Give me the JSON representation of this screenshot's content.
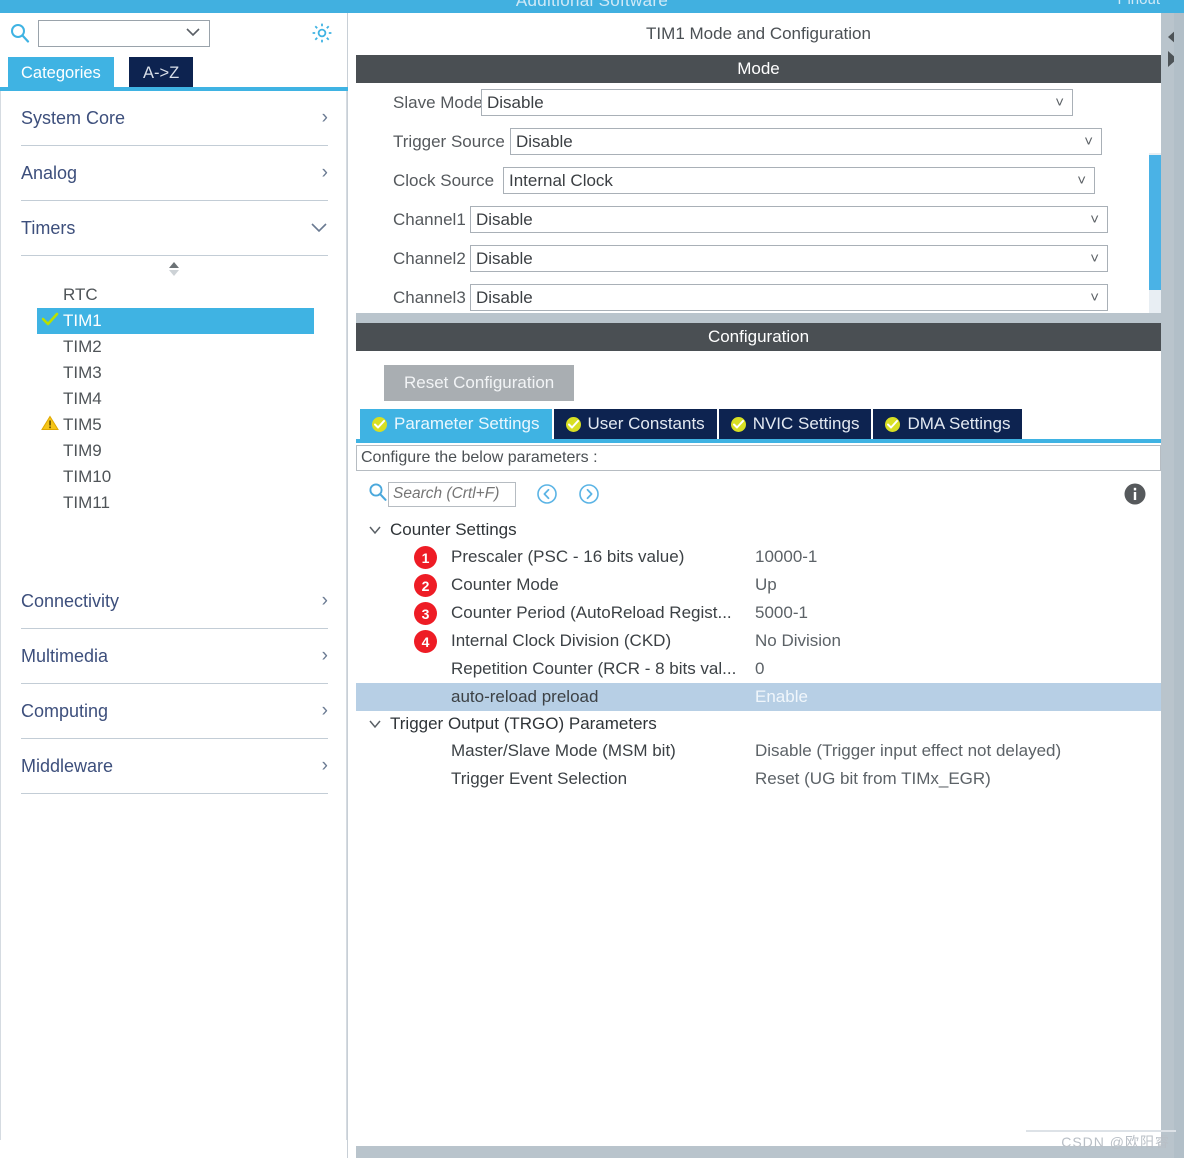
{
  "window": {
    "title": "Additional Software",
    "right_label": "Pinout"
  },
  "sidebar": {
    "search": {
      "icon": "search-icon",
      "value": "",
      "placeholder": ""
    },
    "gear_icon": "gear-icon",
    "tabs": [
      {
        "label": "Categories",
        "active": true
      },
      {
        "label": "A->Z",
        "active": false
      }
    ],
    "categories": [
      {
        "label": "System Core",
        "expanded": false,
        "arrow": "chevron-right-icon"
      },
      {
        "label": "Analog",
        "expanded": false,
        "arrow": "chevron-right-icon"
      },
      {
        "label": "Timers",
        "expanded": true,
        "arrow": "chevron-down-icon"
      },
      {
        "label": "Connectivity",
        "expanded": false,
        "arrow": "chevron-right-icon"
      },
      {
        "label": "Multimedia",
        "expanded": false,
        "arrow": "chevron-right-icon"
      },
      {
        "label": "Computing",
        "expanded": false,
        "arrow": "chevron-right-icon"
      },
      {
        "label": "Middleware",
        "expanded": false,
        "arrow": "chevron-right-icon"
      }
    ],
    "timers": [
      {
        "label": "RTC",
        "status": "none",
        "selected": false
      },
      {
        "label": "TIM1",
        "status": "check",
        "selected": true
      },
      {
        "label": "TIM2",
        "status": "none",
        "selected": false
      },
      {
        "label": "TIM3",
        "status": "none",
        "selected": false
      },
      {
        "label": "TIM4",
        "status": "none",
        "selected": false
      },
      {
        "label": "TIM5",
        "status": "warning",
        "selected": false
      },
      {
        "label": "TIM9",
        "status": "none",
        "selected": false
      },
      {
        "label": "TIM10",
        "status": "none",
        "selected": false
      },
      {
        "label": "TIM11",
        "status": "none",
        "selected": false
      }
    ]
  },
  "main": {
    "header_title": "TIM1 Mode and Configuration",
    "mode_band": "Mode",
    "mode_rows": [
      {
        "label": "Slave Mode",
        "value": "Disable",
        "label_w": 88,
        "field_w": 592
      },
      {
        "label": "Trigger Source",
        "value": "Disable",
        "label_w": 117,
        "field_w": 592
      },
      {
        "label": "Clock Source",
        "value": "Internal Clock",
        "label_w": 110,
        "field_w": 592
      },
      {
        "label": "Channel1",
        "value": "Disable",
        "label_w": 77,
        "field_w": 638
      },
      {
        "label": "Channel2",
        "value": "Disable",
        "label_w": 77,
        "field_w": 638
      },
      {
        "label": "Channel3",
        "value": "Disable",
        "label_w": 77,
        "field_w": 638
      }
    ],
    "configuration_band": "Configuration",
    "reset_button": "Reset Configuration",
    "config_tabs": [
      {
        "label": "Parameter Settings",
        "active": true,
        "badge": "check-badge-icon"
      },
      {
        "label": "User Constants",
        "active": false,
        "badge": "check-badge-icon"
      },
      {
        "label": "NVIC Settings",
        "active": false,
        "badge": "check-badge-icon"
      },
      {
        "label": "DMA Settings",
        "active": false,
        "badge": "check-badge-icon"
      }
    ],
    "configure_hint": "Configure the below parameters :",
    "param_search": {
      "placeholder": "Search (Crtl+F)",
      "value": ""
    },
    "nav_prev_icon": "circle-left-arrow-icon",
    "nav_next_icon": "circle-right-arrow-icon",
    "info_icon": "info-icon",
    "groups": [
      {
        "title": "Counter Settings",
        "expanded": true,
        "rows": [
          {
            "badge": "1",
            "name": "Prescaler (PSC - 16 bits value)",
            "value": "10000-1",
            "highlight": false
          },
          {
            "badge": "2",
            "name": "Counter Mode",
            "value": "Up",
            "highlight": false
          },
          {
            "badge": "3",
            "name": "Counter Period (AutoReload Regist...",
            "value": "5000-1",
            "highlight": false
          },
          {
            "badge": "4",
            "name": "Internal Clock Division (CKD)",
            "value": "No Division",
            "highlight": false
          },
          {
            "badge": "",
            "name": "Repetition Counter (RCR - 8 bits val...",
            "value": "0",
            "highlight": false
          },
          {
            "badge": "",
            "name": "auto-reload preload",
            "value": "Enable",
            "highlight": true
          }
        ]
      },
      {
        "title": "Trigger Output (TRGO) Parameters",
        "expanded": true,
        "rows": [
          {
            "badge": "",
            "name": "Master/Slave Mode (MSM bit)",
            "value": "Disable (Trigger input effect not delayed)",
            "highlight": false
          },
          {
            "badge": "",
            "name": "Trigger Event Selection",
            "value": "Reset (UG bit from TIMx_EGR)",
            "highlight": false
          }
        ]
      }
    ]
  },
  "watermark": "CSDN @欧阳睿",
  "colors": {
    "accent_blue": "#3fb3e3",
    "tab_navy": "#0d2350",
    "band_gray": "#4a4f53",
    "badge_red": "#ee1c25",
    "badge_yellow": "#d7df23",
    "warning_yellow": "#f2c019",
    "check_green": "#9fd400",
    "highlight_row": "#b7cfe5"
  }
}
